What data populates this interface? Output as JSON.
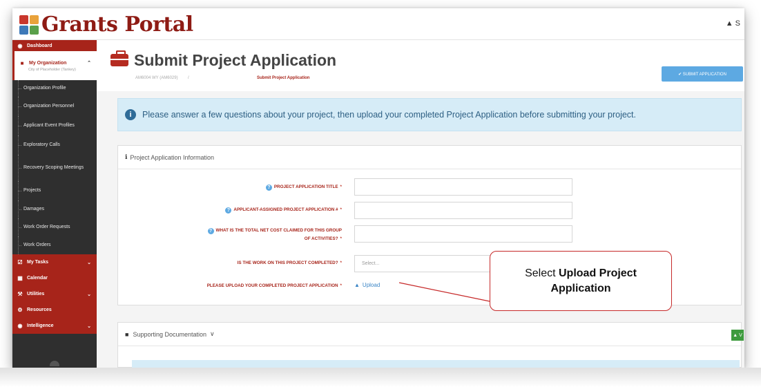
{
  "header": {
    "logo_text": "Grants Portal",
    "user_label": "▲ S",
    "logo_colors": [
      "#c9372c",
      "#e9a23b",
      "#3d79b8",
      "#5aa04a"
    ]
  },
  "sidebar": {
    "dashboard": "Dashboard",
    "organization": {
      "label": "My Organization",
      "sub": "City of Placeholder (Tankey)"
    },
    "subitems": [
      "Organization Profile",
      "Organization Personnel",
      "Applicant Event Profiles",
      "Exploratory Calls",
      "Recovery Scoping Meetings",
      "Projects",
      "Damages",
      "Work Order Requests",
      "Work Orders"
    ],
    "bottom": [
      {
        "label": "My Tasks",
        "icon": "checkbox-icon",
        "chevron": true
      },
      {
        "label": "Calendar",
        "icon": "calendar-icon",
        "chevron": false
      },
      {
        "label": "Utilities",
        "icon": "wrench-icon",
        "chevron": true
      },
      {
        "label": "Resources",
        "icon": "resources-icon",
        "chevron": false
      },
      {
        "label": "Intelligence",
        "icon": "eye-icon",
        "chevron": true
      }
    ]
  },
  "page": {
    "title": "Submit Project Application",
    "breadcrumb_1": "AM6004 WY (AM6029)",
    "breadcrumb_sep": "/",
    "breadcrumb_2": "Submit Project Application",
    "submit_button": "✔ SUBMIT APPLICATION"
  },
  "info_banner": "Please answer a few questions about your project, then upload your completed Project Application before submitting your project.",
  "form": {
    "section_title": "Project Application Information",
    "fields": {
      "title": "PROJECT APPLICATION TITLE",
      "number": "APPLICANT-ASSIGNED PROJECT APPLICATION #",
      "cost": "WHAT IS THE TOTAL NET COST CLAIMED FOR THIS GROUP OF ACTIVITIES?",
      "completed": "IS THE WORK ON THIS PROJECT COMPLETED?",
      "upload": "PLEASE UPLOAD YOUR COMPLETED PROJECT APPLICATION"
    },
    "required_mark": "*",
    "select_placeholder": "Select...",
    "upload_link": "Upload"
  },
  "supporting": {
    "title": "Supporting Documentation",
    "chevron": "∨",
    "green_button": "▲ V"
  },
  "callout": {
    "prefix": "Select",
    "bold": "Upload Project",
    "line2": "Application",
    "border_color": "#c62828"
  }
}
